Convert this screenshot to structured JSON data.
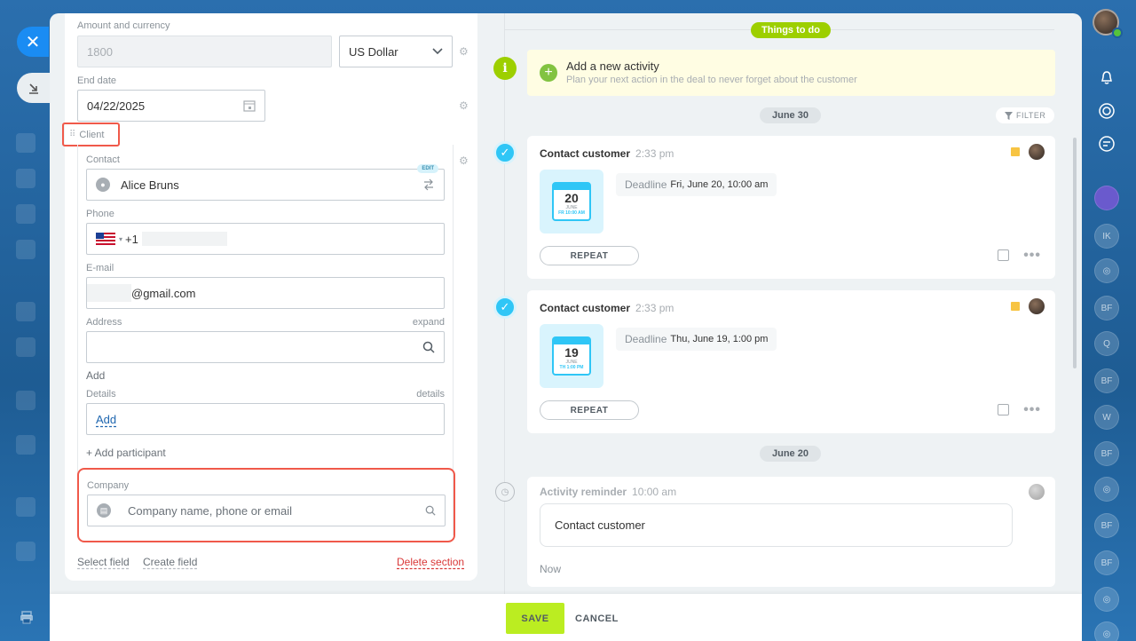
{
  "form": {
    "amount_label": "Amount and currency",
    "amount_value": "1800",
    "currency_value": "US Dollar",
    "end_date_label": "End date",
    "end_date_value": "04/22/2025",
    "client_section_title": "Client",
    "contact_label": "Contact",
    "contact_edit_badge": "EDIT",
    "contact_value": "Alice Bruns",
    "phone_label": "Phone",
    "phone_prefix": "+1",
    "email_label": "E-mail",
    "email_value": "@gmail.com",
    "address_label": "Address",
    "address_expand": "expand",
    "address_add": "Add",
    "details_label": "Details",
    "details_link": "details",
    "details_add": "Add",
    "add_participant": "+ Add participant",
    "company_label": "Company",
    "company_placeholder": "Company name, phone or email",
    "select_field": "Select field",
    "create_field": "Create field",
    "delete_section": "Delete section"
  },
  "timeline": {
    "things_to_do": "Things to do",
    "add_activity_title": "Add a new activity",
    "add_activity_hint": "Plan your next action in the deal to never forget about the customer",
    "date_june30": "June 30",
    "filter": "FILTER",
    "activities": [
      {
        "title": "Contact customer",
        "time": "2:33 pm",
        "cal_day": "20",
        "cal_month": "JUNE",
        "cal_time": "FR 10:00 AM",
        "deadline_key": "Deadline",
        "deadline_value": "Fri, June 20, 10:00 am",
        "repeat": "REPEAT"
      },
      {
        "title": "Contact customer",
        "time": "2:33 pm",
        "cal_day": "19",
        "cal_month": "JUNE",
        "cal_time": "TH 1:00 PM",
        "deadline_key": "Deadline",
        "deadline_value": "Thu, June 19, 1:00 pm",
        "repeat": "REPEAT"
      }
    ],
    "date_june20": "June 20",
    "reminder_title": "Activity reminder",
    "reminder_time": "10:00 am",
    "reminder_text": "Contact customer",
    "reminder_now": "Now"
  },
  "footer": {
    "save": "SAVE",
    "cancel": "CANCEL"
  },
  "rail": {
    "initials": [
      "IK",
      "BF",
      "Q",
      "BF",
      "W",
      "BF",
      "BF",
      "BF"
    ]
  },
  "colors": {
    "accent_green": "#9dcf00",
    "save_green": "#bbed21",
    "highlight_red": "#f0594a",
    "blue": "#2fc6f6"
  }
}
